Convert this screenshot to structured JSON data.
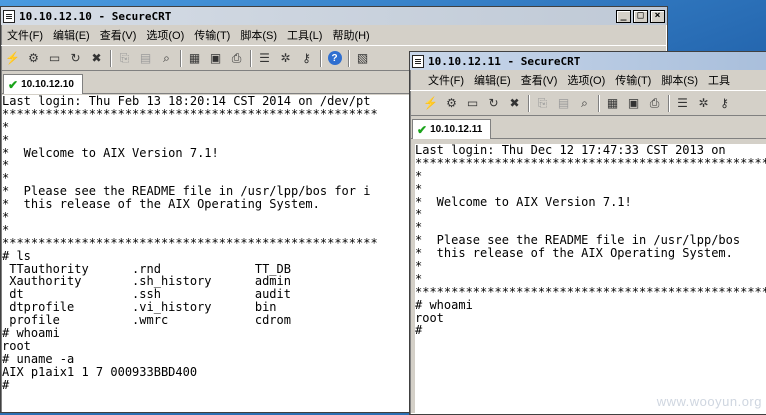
{
  "window1": {
    "title": "10.10.12.10 - SecureCRT",
    "menus": [
      "文件(F)",
      "编辑(E)",
      "查看(V)",
      "选项(O)",
      "传输(T)",
      "脚本(S)",
      "工具(L)",
      "帮助(H)"
    ],
    "tab": "10.10.12.10",
    "lines": [
      "Last login: Thu Feb 13 18:20:14 CST 2014 on /dev/pt",
      "****************************************************",
      "*",
      "*",
      "*  Welcome to AIX Version 7.1!",
      "*",
      "*",
      "*  Please see the README file in /usr/lpp/bos for i",
      "*  this release of the AIX Operating System.",
      "*",
      "*",
      "****************************************************",
      "# ls",
      " TTauthority      .rnd             TT_DB",
      " Xauthority       .sh_history      admin",
      " dt               .ssh             audit",
      " dtprofile        .vi_history      bin",
      " profile          .wmrc            cdrom",
      "# whoami",
      "root",
      "# uname -a",
      "AIX p1aix1 1 7 000933BBD400",
      "#"
    ]
  },
  "window2": {
    "title": "10.10.12.11 - SecureCRT",
    "menus": [
      "文件(F)",
      "编辑(E)",
      "查看(V)",
      "选项(O)",
      "传输(T)",
      "脚本(S)",
      "工具"
    ],
    "tab": "10.10.12.11",
    "lines": [
      "Last login: Thu Dec 12 17:47:33 CST 2013 on",
      "**************************************************",
      "*",
      "*",
      "*  Welcome to AIX Version 7.1!",
      "*",
      "*",
      "*  Please see the README file in /usr/lpp/bos",
      "*  this release of the AIX Operating System.",
      "*",
      "*",
      "**************************************************",
      "# whoami",
      "root",
      "#"
    ]
  },
  "watermark": "www.wooyun.org"
}
